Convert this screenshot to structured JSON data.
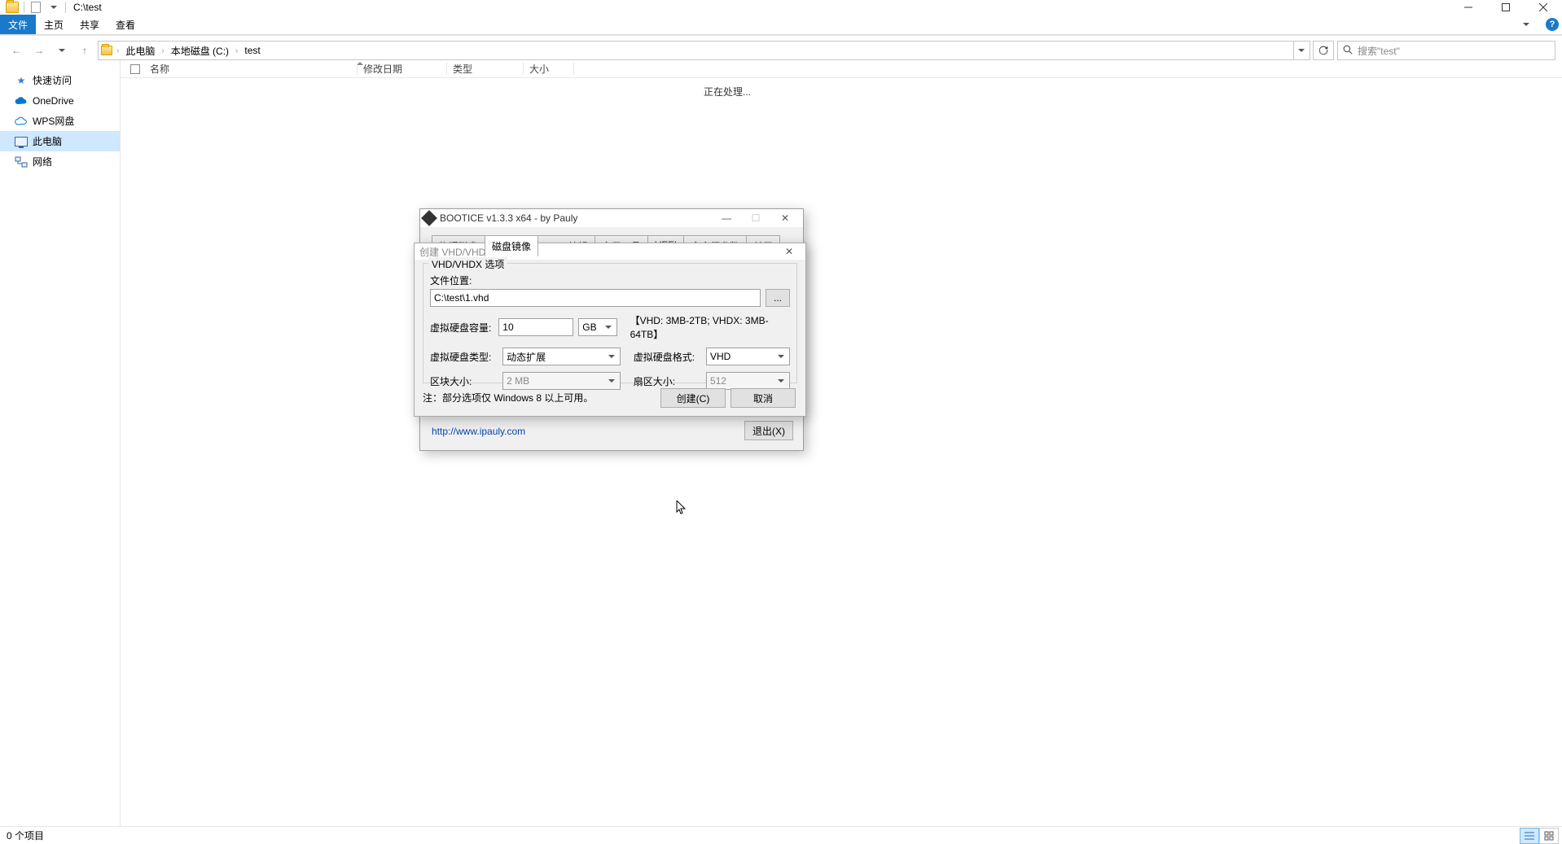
{
  "explorer": {
    "title": "C:\\test",
    "ribbon": {
      "file": "文件",
      "home": "主页",
      "share": "共享",
      "view": "查看"
    },
    "breadcrumb": {
      "root": "此电脑",
      "drive": "本地磁盘 (C:)",
      "folder": "test"
    },
    "search_placeholder": "搜索\"test\"",
    "columns": {
      "name": "名称",
      "date": "修改日期",
      "type": "类型",
      "size": "大小"
    },
    "processing": "正在处理...",
    "sidebar": {
      "quick": "快速访问",
      "onedrive": "OneDrive",
      "wps": "WPS网盘",
      "pc": "此电脑",
      "network": "网络"
    },
    "status": "0 个项目"
  },
  "bootice": {
    "title": "BOOTICE v1.3.3 x64 - by Pauly",
    "tabs": {
      "physical": "物理磁盘",
      "image": "磁盘镜像",
      "bcd": "BCD 编辑",
      "tools": "实用工具",
      "uefi": "UEFI",
      "cmdline": "命令行参数",
      "about": "关于"
    },
    "link": "http://www.ipauly.com",
    "exit": "退出(X)"
  },
  "vhd": {
    "title": "创建 VHD/VHDX 文件",
    "group": "VHD/VHDX 选项",
    "file_location_label": "文件位置:",
    "file_path": "C:\\test\\1.vhd",
    "browse": "...",
    "capacity_label": "虚拟硬盘容量:",
    "capacity_value": "10",
    "capacity_unit": "GB",
    "capacity_hint": "【VHD: 3MB-2TB; VHDX: 3MB-64TB】",
    "type_label": "虚拟硬盘类型:",
    "type_value": "动态扩展",
    "format_label": "虚拟硬盘格式:",
    "format_value": "VHD",
    "block_label": "区块大小:",
    "block_value": "2 MB",
    "sector_label": "扇区大小:",
    "sector_value": "512",
    "note": "注：部分选项仅 Windows 8 以上可用。",
    "create": "创建(C)",
    "cancel": "取消"
  }
}
